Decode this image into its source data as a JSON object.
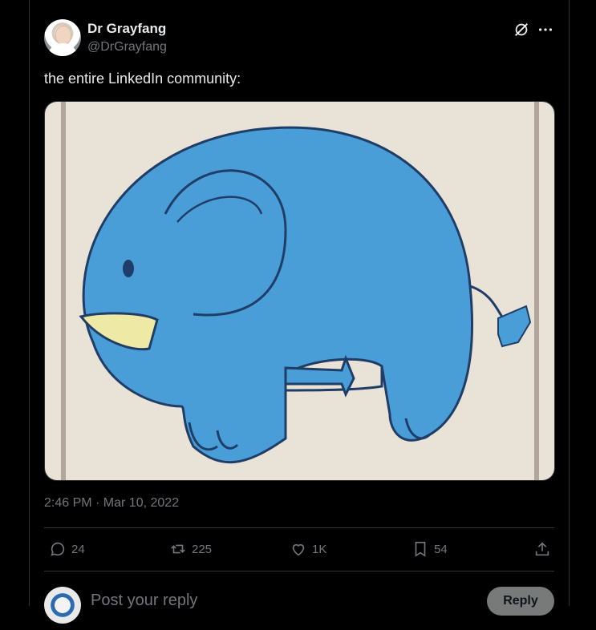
{
  "post": {
    "author": {
      "display_name": "Dr Grayfang",
      "handle": "@DrGrayfang"
    },
    "text": "the entire LinkedIn community:",
    "timestamp": "2:46 PM · Mar 10, 2022",
    "media": {
      "description_icon": "blue-elephant-drawing"
    }
  },
  "actions": {
    "replies": "24",
    "reposts": "225",
    "likes": "1K",
    "bookmarks": "54"
  },
  "reply_box": {
    "placeholder": "Post your reply",
    "button_label": "Reply"
  },
  "colors": {
    "background": "#000000",
    "text_primary": "#e7e9ea",
    "text_secondary": "#71767b",
    "border": "#2f3336",
    "elephant_blue": "#4a9ed8"
  }
}
